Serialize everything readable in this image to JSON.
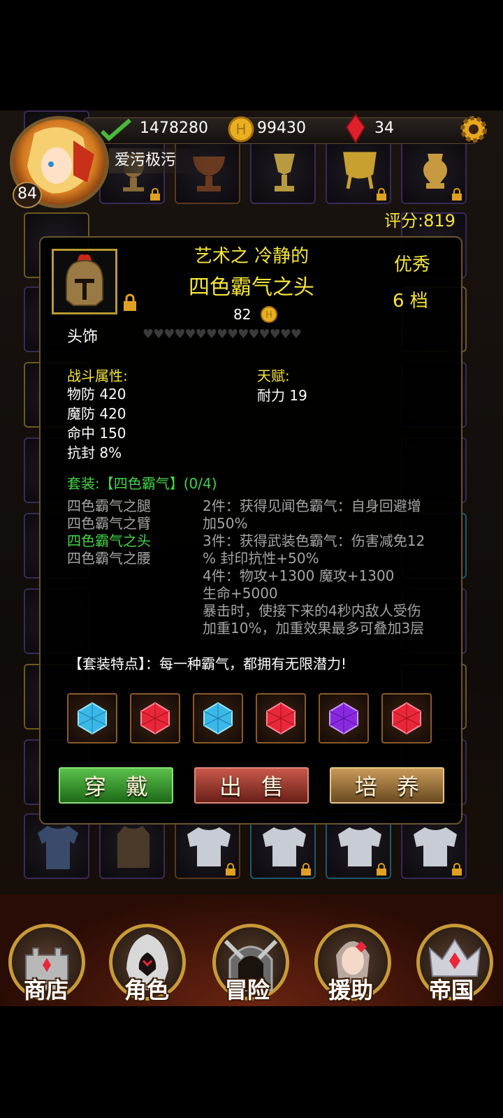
{
  "player": {
    "level": "84",
    "name": "爱污极污",
    "experience": "1478280",
    "gold": "99430",
    "gems": "34",
    "score_label": "评分:819"
  },
  "item": {
    "title_line1": "艺术之 冷静的",
    "title_line2": "四色霸气之头",
    "price": "82",
    "quality": "优秀",
    "tier": "6 档",
    "slot": "头饰",
    "combat_header": "战斗属性:",
    "combat_stats": [
      "物防 420",
      "魔防 420",
      "命中 150",
      "抗封 8%"
    ],
    "talent_header": "天赋:",
    "talent_stats": [
      "耐力 19"
    ],
    "set_header": "套装:【四色霸气】(0/4)",
    "set_pieces": [
      {
        "name": "四色霸气之腿",
        "active": false
      },
      {
        "name": "四色霸气之臂",
        "active": false
      },
      {
        "name": "四色霸气之头",
        "active": true
      },
      {
        "name": "四色霸气之腰",
        "active": false
      }
    ],
    "set_bonuses": [
      "2件：获得见闻色霸气：自身回避增",
      "加50%",
      "3件：获得武装色霸气：伤害减免12",
      "% 封印抗性+50%",
      "4件：物攻+1300 魔攻+1300",
      "生命+5000",
      "暴击时，使接下来的4秒内敌人受伤",
      "加重10%，加重效果最多可叠加3层"
    ],
    "set_feature": "【套装特点】：每一种霸气，都拥有无限潜力!",
    "gems": [
      "blue",
      "red",
      "blue",
      "red",
      "purple",
      "red"
    ]
  },
  "buttons": {
    "equip": "穿戴",
    "sell": "出售",
    "train": "培养"
  },
  "nav": [
    "商店",
    "角色",
    "冒险",
    "援助",
    "帝国"
  ],
  "colors": {
    "gem_blue": "#3ab8e8",
    "gem_red": "#e8283a",
    "gem_purple": "#8a2ae0",
    "highlight": "#f5e63a",
    "set_active": "#44d44a"
  }
}
